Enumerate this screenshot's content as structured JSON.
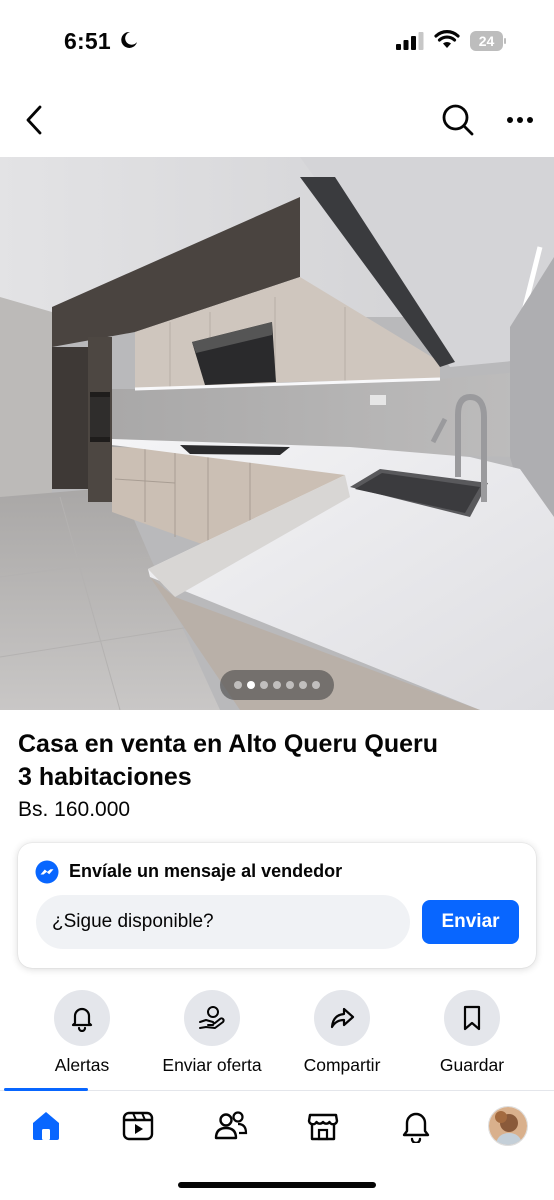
{
  "status_bar": {
    "time": "6:51",
    "battery": "24"
  },
  "listing": {
    "title_line1": "Casa en venta en Alto Queru Queru",
    "title_line2": "3 habitaciones",
    "price": "Bs. 160.000"
  },
  "carousel": {
    "total": 7,
    "active": 1
  },
  "message_card": {
    "header": "Envíale un mensaje al vendedor",
    "input_value": "¿Sigue disponible?",
    "send_label": "Enviar"
  },
  "actions": {
    "alerts": "Alertas",
    "offer": "Enviar oferta",
    "share": "Compartir",
    "save": "Guardar"
  },
  "colors": {
    "accent": "#0866ff",
    "action_bg": "#e4e6eb",
    "input_bg": "#f0f2f5"
  }
}
